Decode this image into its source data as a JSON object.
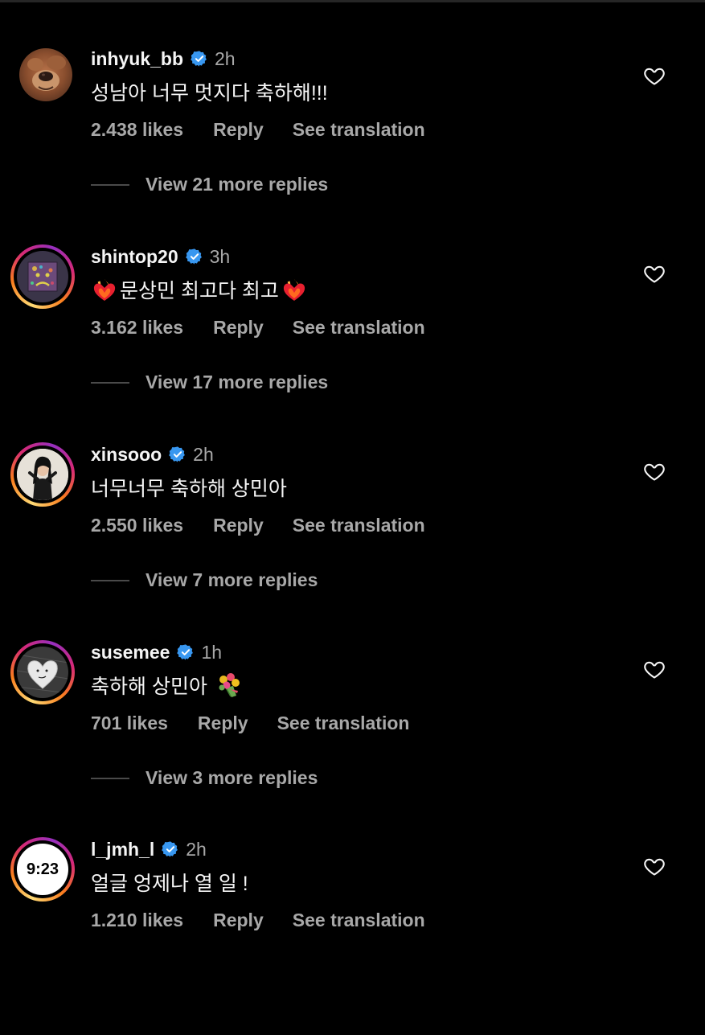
{
  "comments": [
    {
      "username": "inhyuk_bb",
      "verified": true,
      "time": "2h",
      "text": "성남아 너무 멋지다 축하해!!!",
      "likes": "2.438 likes",
      "reply": "Reply",
      "translate": "See translation",
      "view_replies": "View 21 more replies",
      "avatar": "dog-photo",
      "story_ring": false
    },
    {
      "username": "shintop20",
      "verified": true,
      "time": "3h",
      "text_parts": [
        "heart-on-fire-emoji",
        "문상민 최고다 최고",
        "heart-on-fire-emoji"
      ],
      "text": "문상민 최고다 최고",
      "likes": "3.162 likes",
      "reply": "Reply",
      "translate": "See translation",
      "view_replies": "View 17 more replies",
      "avatar": "sad-face-artwork",
      "story_ring": true
    },
    {
      "username": "xinsooo",
      "verified": true,
      "time": "2h",
      "text": "너무너무 축하해 상민아",
      "likes": "2.550 likes",
      "reply": "Reply",
      "translate": "See translation",
      "view_replies": "View 7 more replies",
      "avatar": "person-photo",
      "story_ring": true
    },
    {
      "username": "susemee",
      "verified": true,
      "time": "1h",
      "text": "축하해 상민아",
      "text_suffix_emoji": "bouquet-emoji",
      "likes": "701 likes",
      "reply": "Reply",
      "translate": "See translation",
      "view_replies": "View 3 more replies",
      "avatar": "heart-sketch",
      "story_ring": true
    },
    {
      "username": "l_jmh_l",
      "verified": true,
      "time": "2h",
      "text": "얼글 엉제나 열 일 !",
      "likes": "1.210 likes",
      "reply": "Reply",
      "translate": "See translation",
      "avatar_label": "9:23",
      "avatar": "clock-badge",
      "story_ring": true
    }
  ],
  "colors": {
    "background": "#000000",
    "text": "#f5f5f5",
    "secondary": "#a8a8a8",
    "verified": "#3897f0"
  }
}
